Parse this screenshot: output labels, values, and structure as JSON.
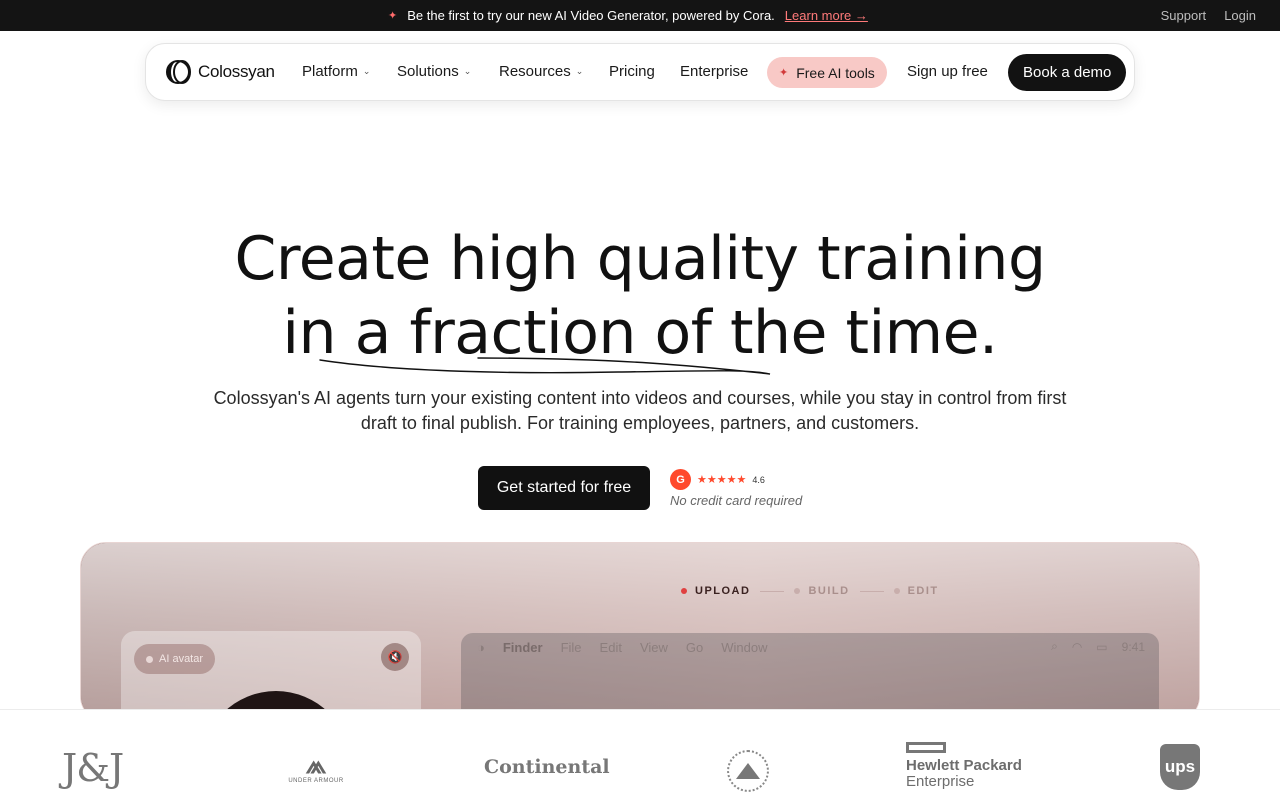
{
  "announcement": {
    "message": "Be the first to try our new AI Video Generator, powered by Cora.",
    "link": "Learn more →",
    "support": "Support",
    "login": "Login"
  },
  "nav": {
    "brand": "Colossyan",
    "items": [
      "Platform",
      "Solutions",
      "Resources",
      "Pricing",
      "Enterprise"
    ],
    "free_tools": "Free AI tools",
    "signup": "Sign up free",
    "demo": "Book a demo"
  },
  "hero": {
    "title_line1": "Create high quality training",
    "title_line2": "in a fraction of the time.",
    "subtitle": "Colossyan's AI agents turn your existing content into videos and courses, while you stay in control from first draft to final publish. For training employees, partners, and customers.",
    "cta": "Get started for free",
    "g2_letter": "G",
    "stars": "★★★★★",
    "rating": "4.6",
    "no_credit": "No credit card required"
  },
  "preview": {
    "steps": [
      "UPLOAD",
      "BUILD",
      "EDIT"
    ],
    "active_step": "UPLOAD",
    "avatar_label": "AI avatar",
    "finder_menu": [
      "Finder",
      "File",
      "Edit",
      "View",
      "Go",
      "Window"
    ],
    "time": "9:41"
  },
  "logos": {
    "jj": "J&J",
    "ua": "UNDER ARMOUR",
    "continental": "Continental",
    "hpe_line1": "Hewlett Packard",
    "hpe_line2": "Enterprise",
    "ups": "ups"
  },
  "colors": {
    "accent": "#f8c9c6",
    "announcement_bg": "#141414",
    "cta_bg": "#111111",
    "g2": "#ff492c"
  }
}
